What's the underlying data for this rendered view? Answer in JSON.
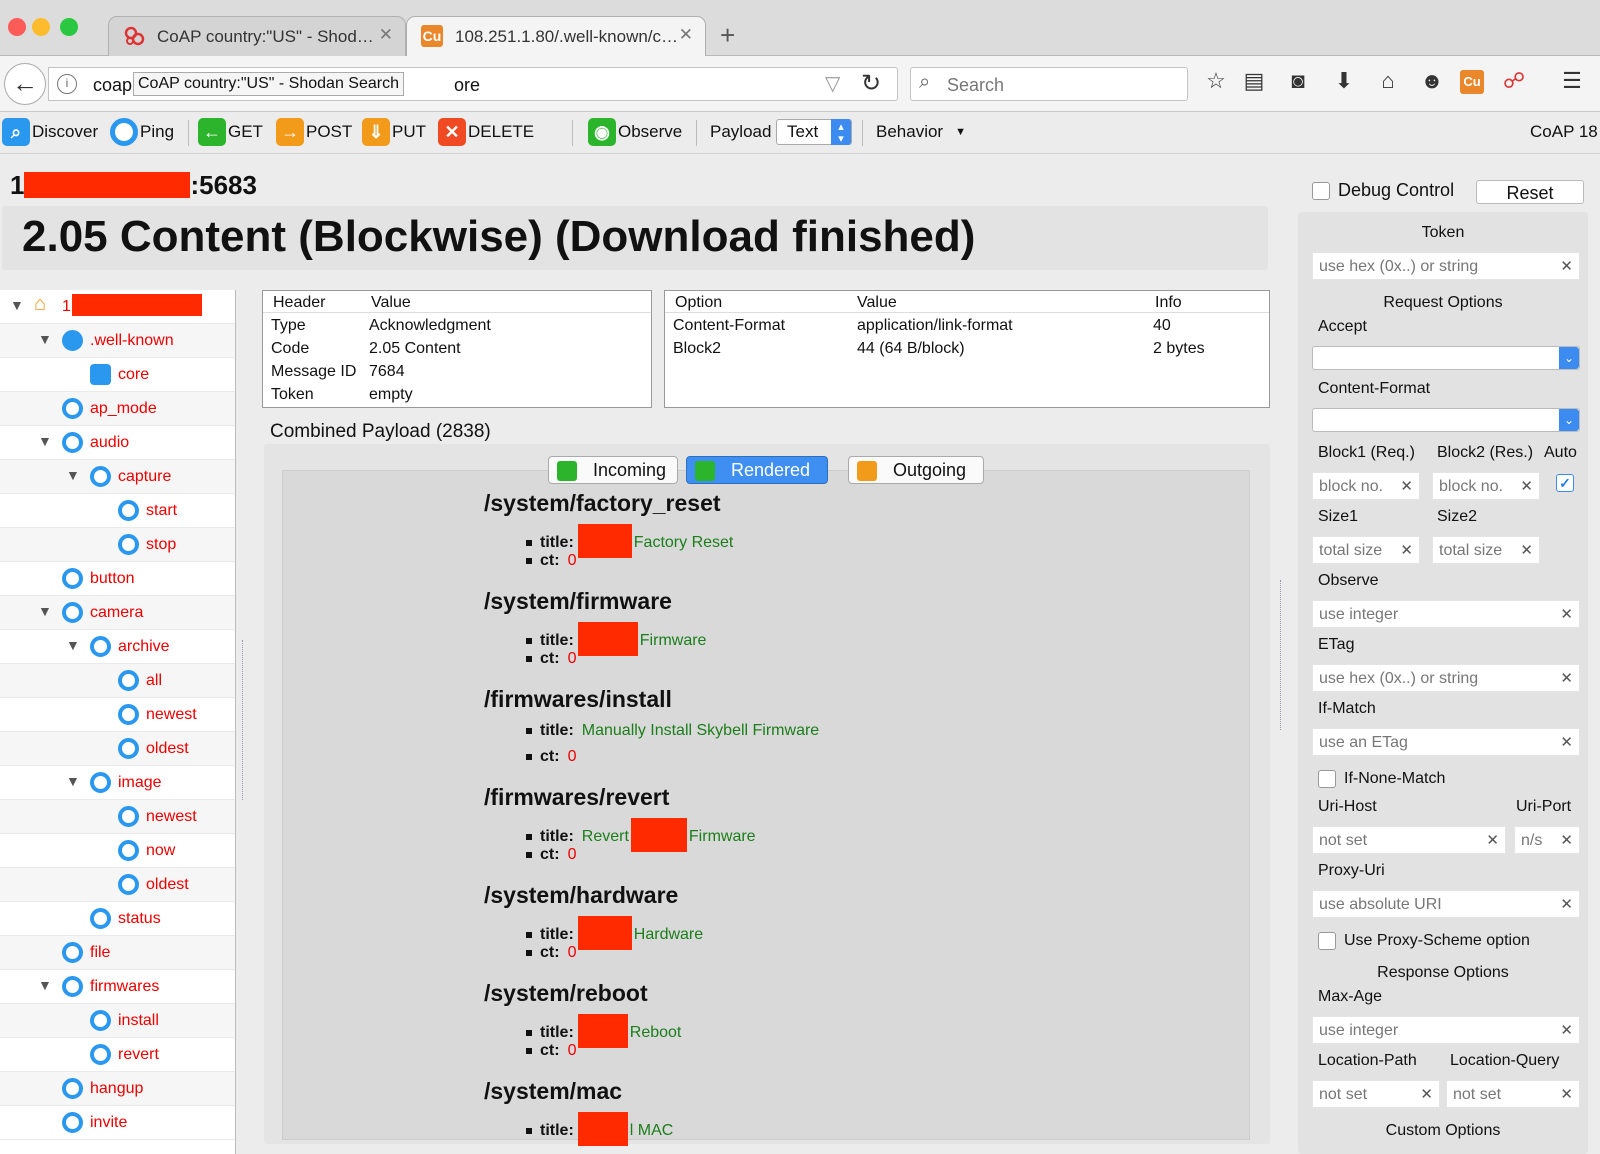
{
  "browser": {
    "tabs": [
      {
        "label": "CoAP country:\"US\" - Shod…"
      },
      {
        "label": "108.251.1.80/.well-known/c…"
      }
    ],
    "url_start": "coap:",
    "url_tooltip": "CoAP country:\"US\" - Shodan Search",
    "url_end": "ore",
    "search_placeholder": "Search"
  },
  "toolbar": {
    "discover": "Discover",
    "ping": "Ping",
    "get": "GET",
    "post": "POST",
    "put": "PUT",
    "delete": "DELETE",
    "observe": "Observe",
    "payload_label": "Payload",
    "payload_value": "Text",
    "behavior": "Behavior",
    "version": "CoAP 18",
    "colors": {
      "green": "#2cb52c",
      "orange": "#f29a1a",
      "red": "#ef4a24",
      "blue": "#2b98f0"
    }
  },
  "address": {
    "prefix": "1",
    "port": ":5683"
  },
  "status": "2.05 Content (Blockwise) (Download finished)",
  "tree": [
    {
      "label": "1",
      "depth": 0,
      "twisty": "▼",
      "icon": "home"
    },
    {
      "label": ".well-known",
      "depth": 1,
      "twisty": "▼",
      "icon": "globe"
    },
    {
      "label": "core",
      "depth": 2,
      "twisty": "",
      "icon": "search"
    },
    {
      "label": "ap_mode",
      "depth": 1,
      "twisty": "",
      "icon": "res"
    },
    {
      "label": "audio",
      "depth": 1,
      "twisty": "▼",
      "icon": "res"
    },
    {
      "label": "capture",
      "depth": 2,
      "twisty": "▼",
      "icon": "res"
    },
    {
      "label": "start",
      "depth": 3,
      "twisty": "",
      "icon": "res"
    },
    {
      "label": "stop",
      "depth": 3,
      "twisty": "",
      "icon": "res"
    },
    {
      "label": "button",
      "depth": 1,
      "twisty": "",
      "icon": "res"
    },
    {
      "label": "camera",
      "depth": 1,
      "twisty": "▼",
      "icon": "res"
    },
    {
      "label": "archive",
      "depth": 2,
      "twisty": "▼",
      "icon": "res"
    },
    {
      "label": "all",
      "depth": 3,
      "twisty": "",
      "icon": "res"
    },
    {
      "label": "newest",
      "depth": 3,
      "twisty": "",
      "icon": "res"
    },
    {
      "label": "oldest",
      "depth": 3,
      "twisty": "",
      "icon": "res"
    },
    {
      "label": "image",
      "depth": 2,
      "twisty": "▼",
      "icon": "res"
    },
    {
      "label": "newest",
      "depth": 3,
      "twisty": "",
      "icon": "res"
    },
    {
      "label": "now",
      "depth": 3,
      "twisty": "",
      "icon": "res"
    },
    {
      "label": "oldest",
      "depth": 3,
      "twisty": "",
      "icon": "res"
    },
    {
      "label": "status",
      "depth": 2,
      "twisty": "",
      "icon": "res"
    },
    {
      "label": "file",
      "depth": 1,
      "twisty": "",
      "icon": "res"
    },
    {
      "label": "firmwares",
      "depth": 1,
      "twisty": "▼",
      "icon": "res"
    },
    {
      "label": "install",
      "depth": 2,
      "twisty": "",
      "icon": "res"
    },
    {
      "label": "revert",
      "depth": 2,
      "twisty": "",
      "icon": "res"
    },
    {
      "label": "hangup",
      "depth": 1,
      "twisty": "",
      "icon": "res"
    },
    {
      "label": "invite",
      "depth": 1,
      "twisty": "",
      "icon": "res"
    }
  ],
  "header_table": {
    "columns": [
      "Header",
      "Value"
    ],
    "rows": [
      [
        "Type",
        "Acknowledgment"
      ],
      [
        "Code",
        "2.05 Content"
      ],
      [
        "Message ID",
        "7684"
      ],
      [
        "Token",
        "empty"
      ]
    ]
  },
  "option_table": {
    "columns": [
      "Option",
      "Value",
      "Info"
    ],
    "rows": [
      [
        "Content-Format",
        "application/link-format",
        "40"
      ],
      [
        "Block2",
        "44 (64 B/block)",
        "2 bytes"
      ]
    ]
  },
  "payload": {
    "title": "Combined Payload (2838)",
    "tabs": [
      "Incoming",
      "Rendered",
      "Outgoing"
    ],
    "title_label": "title:",
    "ct_label": "ct:",
    "resources": [
      {
        "path": "/system/factory_reset",
        "title": "Factory Reset",
        "ct": "0"
      },
      {
        "path": "/system/firmware",
        "title": "Firmware",
        "ct": "0"
      },
      {
        "path": "/firmwares/install",
        "title": "Manually Install Skybell Firmware",
        "ct": "0"
      },
      {
        "path": "/firmwares/revert",
        "title_pre": "Revert",
        "title": "Firmware",
        "ct": "0"
      },
      {
        "path": "/system/hardware",
        "title": "Hardware",
        "ct": "0"
      },
      {
        "path": "/system/reboot",
        "title": "Reboot",
        "ct": "0"
      },
      {
        "path": "/system/mac",
        "title": "l MAC",
        "ct": ""
      }
    ]
  },
  "debug": {
    "label": "Debug Control",
    "reset": "Reset",
    "token_heading": "Token",
    "token_ph": "use hex (0x..) or string",
    "request_heading": "Request Options",
    "accept": "Accept",
    "content_format": "Content-Format",
    "block1": "Block1 (Req.)",
    "block2": "Block2 (Res.)",
    "auto": "Auto",
    "block_ph": "block no.",
    "size1": "Size1",
    "size2": "Size2",
    "size_ph": "total size",
    "observe": "Observe",
    "observe_ph": "use integer",
    "etag": "ETag",
    "etag_ph": "use hex (0x..) or string",
    "ifmatch": "If-Match",
    "ifmatch_ph": "use an ETag",
    "ifnonematch": "If-None-Match",
    "urihost": "Uri-Host",
    "uriport": "Uri-Port",
    "urihost_ph": "not set",
    "uriport_ph": "n/s",
    "proxyuri": "Proxy-Uri",
    "proxyuri_ph": "use absolute URI",
    "proxyscheme": "Use Proxy-Scheme option",
    "response_heading": "Response Options",
    "maxage": "Max-Age",
    "maxage_ph": "use integer",
    "locpath": "Location-Path",
    "locquery": "Location-Query",
    "loc_ph": "not set",
    "custom": "Custom Options"
  }
}
